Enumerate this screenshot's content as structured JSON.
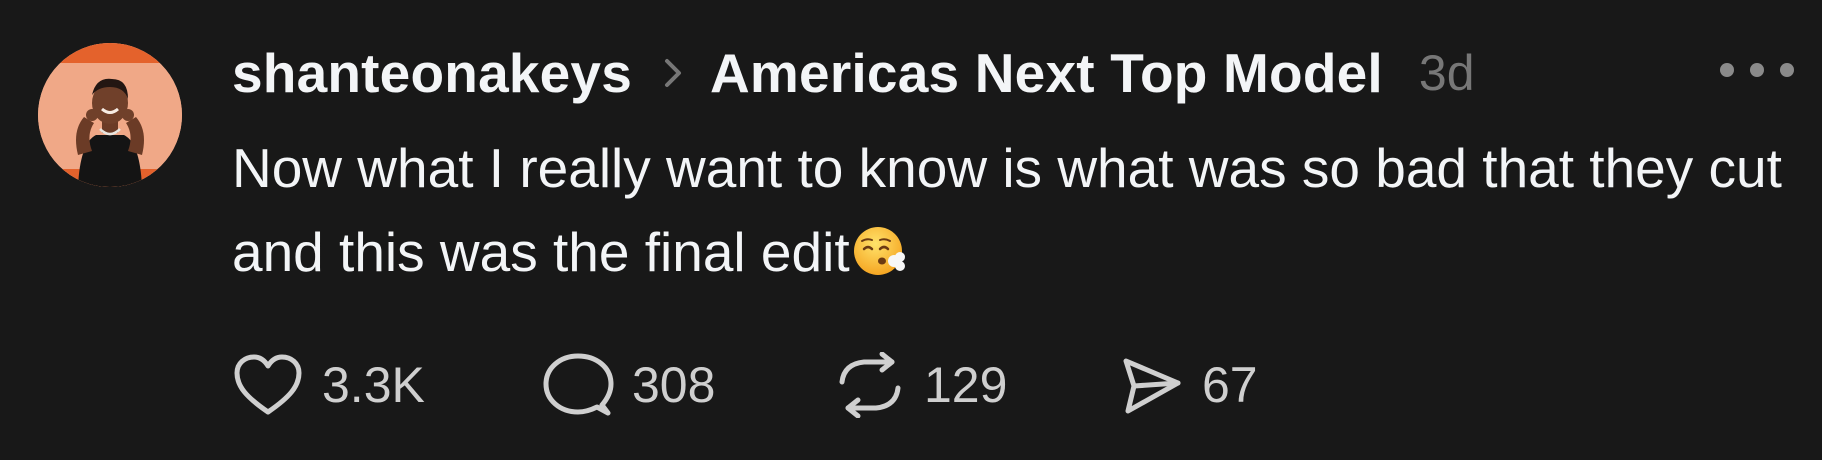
{
  "post": {
    "author": "shanteonakeys",
    "community": "Americas Next Top Model",
    "time": "3d",
    "text": "Now what I really want to know is what was so bad that they cut and this was the final edit",
    "emoji": "😮‍💨",
    "actions": {
      "likes": "3.3K",
      "replies": "308",
      "reposts": "129",
      "shares": "67"
    }
  },
  "icons": {
    "avatar": "profile-photo",
    "breadcrumb": "chevron-right-icon",
    "more": "more-horizontal-icon",
    "like": "heart-icon",
    "reply": "comment-bubble-icon",
    "repost": "repost-icon",
    "share": "send-icon"
  },
  "colors": {
    "background": "#181818",
    "primary_text": "#f3f5f7",
    "secondary_text": "#777777",
    "icon": "#cfcfcf"
  }
}
